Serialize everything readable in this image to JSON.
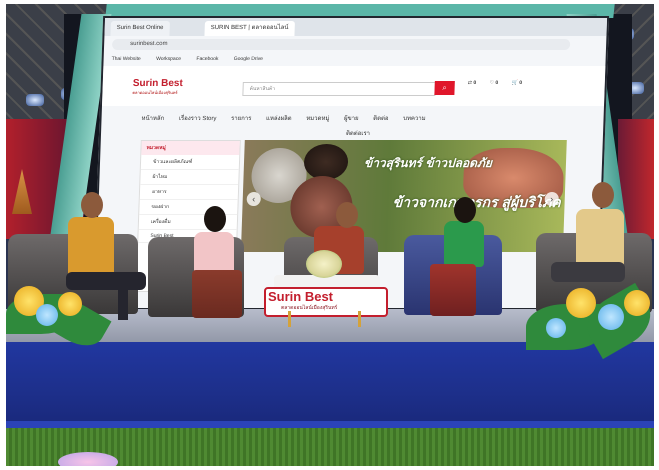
{
  "screen": {
    "tab1": "Surin Best Online",
    "tab2": "SURIN BEST | ตลาดออนไลน์",
    "address": "surinbest.com",
    "bookmarks": [
      "Thai Website",
      "Workspace",
      "Facebook",
      "Google Drive"
    ],
    "logo": "Surin Best",
    "logo_sub": "ตลาดออนไลน์เมืองสุรินทร์",
    "search_placeholder": "ค้นหาสินค้า",
    "user_icons": [
      "0",
      "0",
      "0"
    ],
    "nav": [
      "หน้าหลัก",
      "เรื่องราว Story",
      "รายการ",
      "แหล่งผลิต",
      "หมวดหมู่",
      "ผู้ขาย",
      "ติดต่อ",
      "บทความ"
    ],
    "nav_extra": "ติดต่อเรา",
    "category_header": "หมวดหมู่",
    "categories": [
      "ข้าวและผลิตภัณฑ์",
      "ผ้าไหม",
      "อาหาร",
      "ของฝาก",
      "เครื่องดื่ม",
      "Surin Best"
    ],
    "banner_line1": "ข้าวสุรินทร์ ข้าวปลอดภัย",
    "banner_line2": "ข้าวจากเกษตรกร สู่ผู้บริโภค"
  },
  "stage_sign": {
    "logo": "Surin Best",
    "sub": "ตลาดออนไลน์เมืองสุรินทร์"
  },
  "colors": {
    "brand_red": "#c31e2d",
    "stage_blue": "#1d2f8a",
    "frame_teal": "#5bb6a8"
  }
}
